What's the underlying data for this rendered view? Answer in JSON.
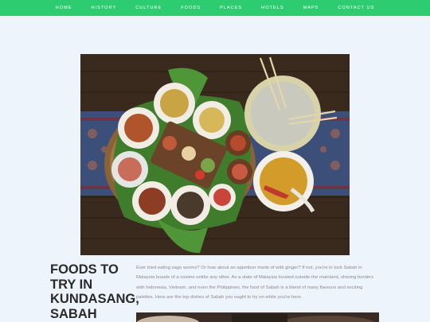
{
  "nav": {
    "items": [
      "HOME",
      "HISTORY",
      "CULTURE",
      "FOODS",
      "PLACES",
      "HOTELS",
      "MAPS",
      "CONTACT US"
    ]
  },
  "hero": {
    "icon": "food-platter-photo"
  },
  "article": {
    "title": "FOODS TO TRY IN KUNDASANG, SABAH",
    "intro": "Ever tried eating sago worms? Or how about an appetizer made of wild ginger? If not, you're in luck Sabah in Malaysia boasts of a cuisine unlike any other. As a state of Malaysia located outside the mainland, sharing borders with Indonesia, Vietnam, and even the Philippines, the food of Sabah is a blend of many flavours and exciting palettes. Here are the top dishes of Sabah you ought to try on while you're here."
  },
  "colors": {
    "nav_bg": "#2ecc71",
    "page_bg": "#eef4fb",
    "title": "#2a2a2a",
    "body_text": "#8a8a8a"
  }
}
